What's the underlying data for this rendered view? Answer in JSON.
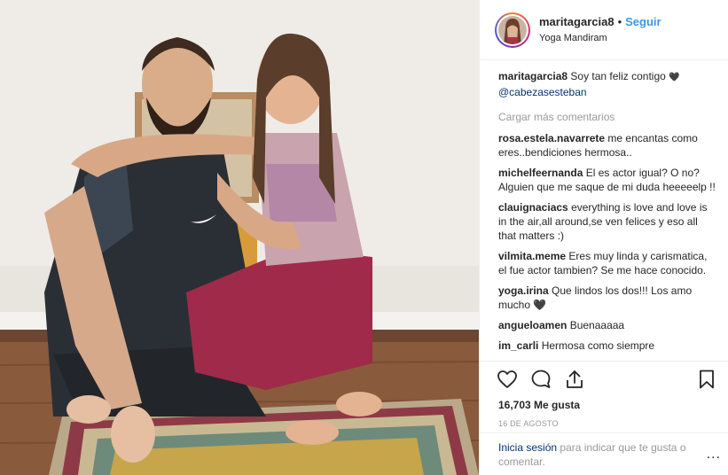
{
  "post": {
    "username": "maritagarcia8",
    "separator": "•",
    "follow_label": "Seguir",
    "location": "Yoga Mandiram",
    "caption": "Soy tan feliz contigo",
    "caption_emoji": "🖤",
    "caption_mention": "@cabezasesteban",
    "load_more": "Cargar más comentarios"
  },
  "comments": [
    {
      "user": "rosa.estela.navarrete",
      "text": "me encantas como eres..bendiciones hermosa.."
    },
    {
      "user": "michelfeernanda",
      "text": "El es actor igual? O no? Alguien que me saque de mi duda heeeeelp !!"
    },
    {
      "user": "clauignaciacs",
      "text": "everything is love and love is in the air,all around,se ven felices y eso all that matters :)"
    },
    {
      "user": "vilmita.meme",
      "text": "Eres muy linda y carismatica, el fue actor tambien? Se me hace conocido."
    },
    {
      "user": "yoga.irina",
      "text": "Que lindos los dos!!! Los amo mucho 🖤"
    },
    {
      "user": "angueloamen",
      "text": "Buenaaaaa"
    },
    {
      "user": "im_carli",
      "text": "Hermosa como siempre"
    }
  ],
  "actions": {
    "like_icon": "heart-icon",
    "comment_icon": "comment-icon",
    "share_icon": "share-icon",
    "save_icon": "bookmark-icon"
  },
  "likes": "16,703 Me gusta",
  "date": "16 DE AGOSTO",
  "footer": {
    "login_label": "Inicia sesión",
    "login_text": "para indicar que te gusta o comentar.",
    "more_label": "..."
  },
  "colors": {
    "link_blue": "#3897f0",
    "mention_navy": "#003569",
    "muted_gray": "#999999",
    "border": "#efefef"
  }
}
